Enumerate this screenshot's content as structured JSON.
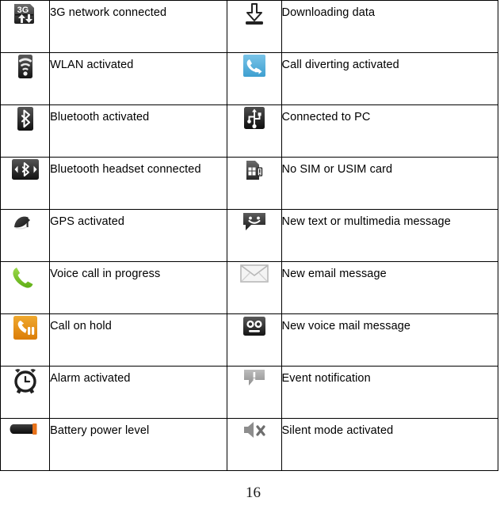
{
  "page": {
    "number": "16",
    "colors": {
      "border": "#000000",
      "text": "#000000",
      "background": "#ffffff",
      "icon_dark": "#2b2b2b",
      "icon_blue": "#5BB4DD",
      "icon_orange": "#E8921E",
      "icon_green": "#74C32B",
      "icon_gray": "#9a9a9a"
    }
  },
  "table": {
    "rows": [
      {
        "left": {
          "icon": "3g-network-icon",
          "label": "3G network connected"
        },
        "right": {
          "icon": "download-icon",
          "label": "Downloading data"
        }
      },
      {
        "left": {
          "icon": "wlan-icon",
          "label": "WLAN activated"
        },
        "right": {
          "icon": "call-diverting-icon",
          "label": "Call diverting activated"
        }
      },
      {
        "left": {
          "icon": "bluetooth-icon",
          "label": "Bluetooth activated"
        },
        "right": {
          "icon": "usb-icon",
          "label": "Connected to PC"
        }
      },
      {
        "left": {
          "icon": "bluetooth-headset-icon",
          "label": "Bluetooth headset connected"
        },
        "right": {
          "icon": "no-sim-card-icon",
          "label": "No SIM or USIM card"
        }
      },
      {
        "left": {
          "icon": "gps-icon",
          "label": "GPS activated"
        },
        "right": {
          "icon": "new-message-icon",
          "label": "New text or multimedia message"
        }
      },
      {
        "left": {
          "icon": "voice-call-icon",
          "label": "Voice call in progress"
        },
        "right": {
          "icon": "new-email-icon",
          "label": "New email message"
        }
      },
      {
        "left": {
          "icon": "call-on-hold-icon",
          "label": "Call on hold"
        },
        "right": {
          "icon": "voicemail-icon",
          "label": "New voice mail message"
        }
      },
      {
        "left": {
          "icon": "alarm-clock-icon",
          "label": "Alarm activated"
        },
        "right": {
          "icon": "event-notification-icon",
          "label": "Event notification"
        }
      },
      {
        "left": {
          "icon": "battery-icon",
          "label": "Battery power level"
        },
        "right": {
          "icon": "silent-mode-icon",
          "label": "Silent mode activated"
        }
      }
    ]
  }
}
